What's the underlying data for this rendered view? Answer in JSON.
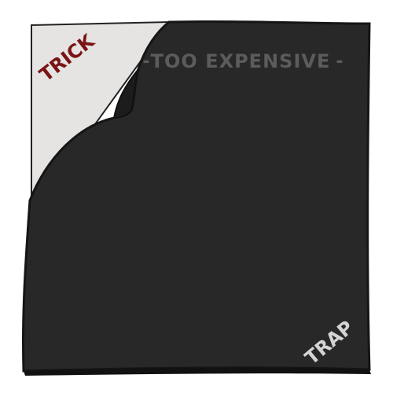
{
  "labels": {
    "corner": "TRICK",
    "banner": "TOO EXPENSIVE",
    "banner_left_dash": "-",
    "banner_right_dash": "-",
    "bottom_corner": "TRAP"
  },
  "colors": {
    "background": "#ffffff",
    "board": "#2a2a2a",
    "board_edge": "#161616",
    "peeled_corner": "#e6e3e3",
    "corner_text": "#7a1414",
    "banner_text": "#5c5c5c",
    "trap_text": "#d4d4d4"
  }
}
